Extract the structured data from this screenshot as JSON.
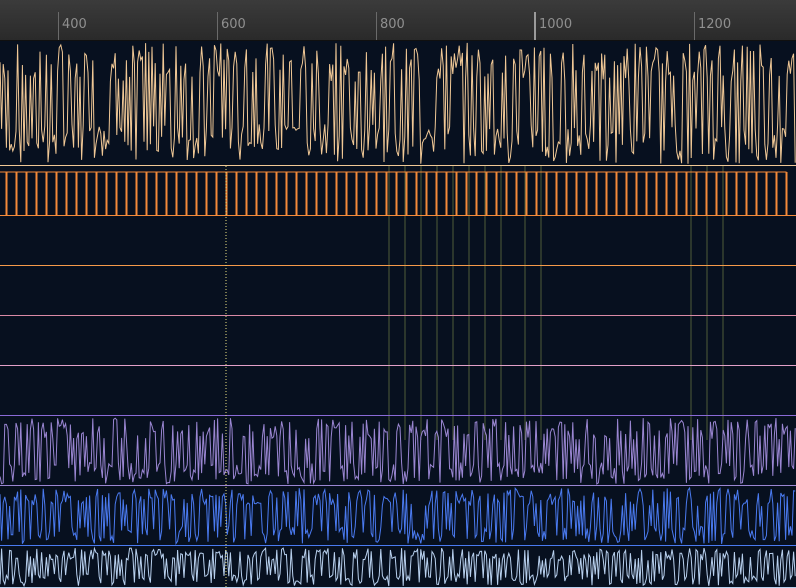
{
  "ruler": {
    "ticks": [
      "400",
      "600",
      "800",
      "1000",
      "1200"
    ]
  },
  "tracks": [
    {
      "id": "track-1",
      "color": "#f0c896",
      "style": "dense-wave"
    },
    {
      "id": "track-2",
      "color": "#f48a3a",
      "style": "spike-train"
    },
    {
      "id": "track-3",
      "color": "#f59a4a",
      "style": "empty"
    },
    {
      "id": "track-4",
      "color": "#d98aa6",
      "style": "empty"
    },
    {
      "id": "track-5",
      "color": "#e2a0c8",
      "style": "empty"
    },
    {
      "id": "track-6",
      "color": "#8a6ad6",
      "style": "empty"
    },
    {
      "id": "track-7",
      "color": "#9a86d2",
      "style": "dense-wave"
    },
    {
      "id": "track-8",
      "color": "#4a7af0",
      "style": "dense-wave"
    },
    {
      "id": "track-9",
      "color": "#b8d0ee",
      "style": "dense-wave"
    }
  ],
  "colors": {
    "background": "#07101f",
    "cursor": "#e8e080",
    "marker_lines": "#4f5b3a"
  }
}
